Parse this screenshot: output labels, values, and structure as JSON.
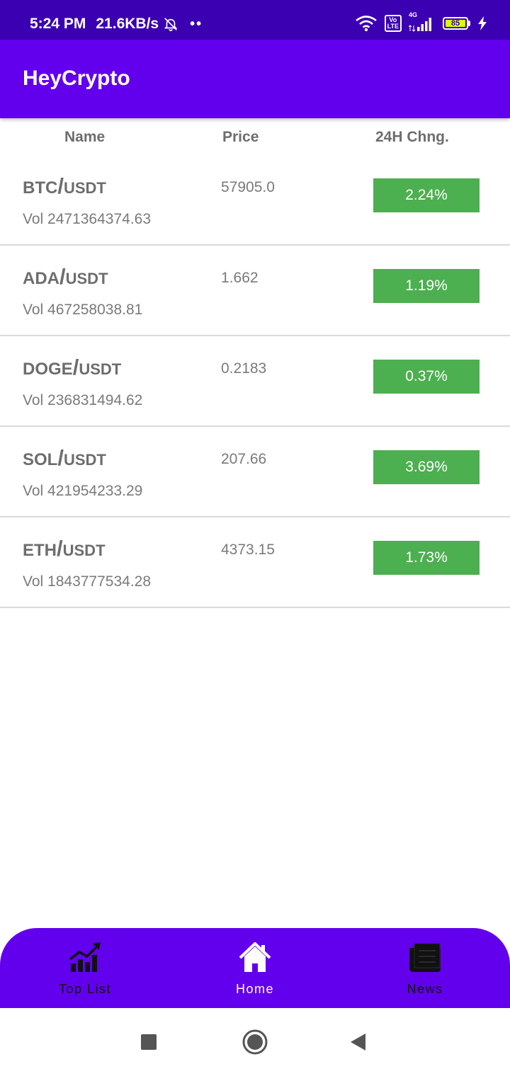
{
  "status_bar": {
    "time": "5:24 PM",
    "net_speed": "21.6KB/s",
    "dots": "••",
    "volte_top": "Vo",
    "volte_bottom": "LTE",
    "signal_label": "4G",
    "battery": "85"
  },
  "app_bar": {
    "title": "HeyCrypto"
  },
  "table": {
    "headers": {
      "name": "Name",
      "price": "Price",
      "change": "24H Chng."
    },
    "rows": [
      {
        "base": "BTC",
        "slash": "/",
        "quote": "USDT",
        "volume": "Vol 2471364374.63",
        "price": "57905.0",
        "change": "2.24%"
      },
      {
        "base": "ADA",
        "slash": "/",
        "quote": "USDT",
        "volume": "Vol 467258038.81",
        "price": "1.662",
        "change": "1.19%"
      },
      {
        "base": "DOGE",
        "slash": "/",
        "quote": "USDT",
        "volume": "Vol 236831494.62",
        "price": "0.2183",
        "change": "0.37%"
      },
      {
        "base": "SOL",
        "slash": "/",
        "quote": "USDT",
        "volume": "Vol 421954233.29",
        "price": "207.66",
        "change": "3.69%"
      },
      {
        "base": "ETH",
        "slash": "/",
        "quote": "USDT",
        "volume": "Vol 1843777534.28",
        "price": "4373.15",
        "change": "1.73%"
      }
    ]
  },
  "bottom_nav": {
    "items": [
      {
        "label": "Top List",
        "icon": "chart-trend-icon",
        "active": false
      },
      {
        "label": "Home",
        "icon": "home-icon",
        "active": true
      },
      {
        "label": "News",
        "icon": "newspaper-icon",
        "active": false
      }
    ]
  },
  "colors": {
    "status_bar": "#3a00b2",
    "primary": "#6200ee",
    "positive_change": "#4caf50",
    "text_muted": "#757575"
  }
}
